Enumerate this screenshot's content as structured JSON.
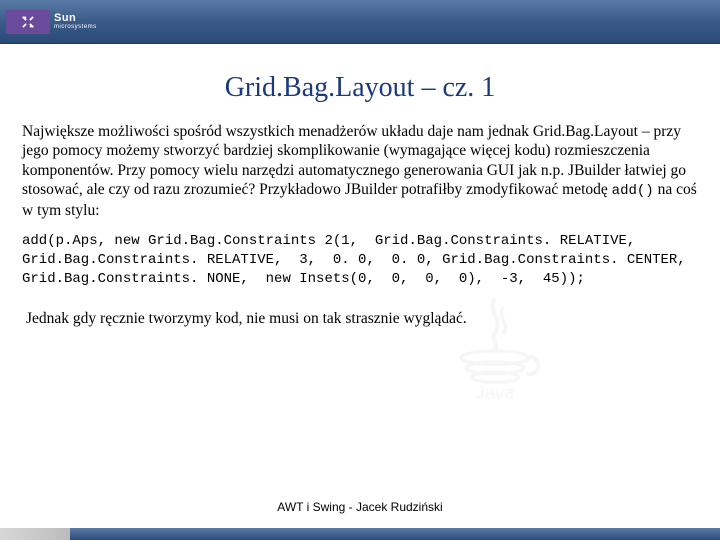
{
  "header": {
    "brand": "Sun",
    "brand_sub": "microsystems"
  },
  "title": "Grid.Bag.Layout – cz. 1",
  "paragraph1_pre": "Największe możliwości spośród wszystkich menadżerów układu daje nam jednak Grid.Bag.Layout – przy jego pomocy możemy stworzyć bardziej skomplikowanie (wymagające więcej kodu) rozmieszczenia komponentów. Przy pomocy wielu narzędzi automatycznego generowania GUI jak n.p. JBuilder łatwiej go stosować, ale czy od razu zrozumieć? Przykładowo JBuilder potrafiłby zmodyfikować metodę ",
  "paragraph1_code": "add()",
  "paragraph1_post": " na coś w tym stylu:",
  "code": "add(p.Aps, new Grid.Bag.Constraints 2(1,  Grid.Bag.Constraints. RELATIVE, Grid.Bag.Constraints. RELATIVE,  3,  0. 0,  0. 0, Grid.Bag.Constraints. CENTER, Grid.Bag.Constraints. NONE,  new Insets(0,  0,  0,  0),  -3,  45));",
  "paragraph2": "Jednak gdy ręcznie tworzymy kod, nie musi on tak strasznie wyglądać.",
  "footer": "AWT i Swing - Jacek Rudziński"
}
